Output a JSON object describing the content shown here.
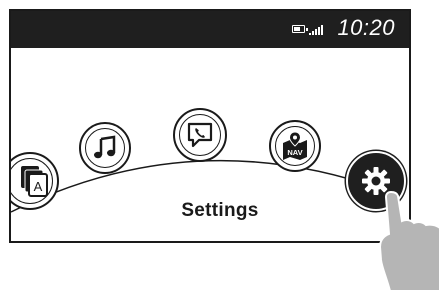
{
  "status_bar": {
    "time": "10:20",
    "battery_icon": "battery-icon",
    "signal_icon": "signal-icon"
  },
  "carousel": {
    "items": [
      {
        "name": "apps",
        "icon": "app-stack-icon",
        "letter": "A"
      },
      {
        "name": "music",
        "icon": "music-note-icon"
      },
      {
        "name": "phone",
        "icon": "phone-message-icon"
      },
      {
        "name": "navigation",
        "icon": "nav-map-icon",
        "letter": "NAV"
      },
      {
        "name": "settings",
        "icon": "gear-icon",
        "selected": true
      }
    ],
    "selected_label": "Settings"
  },
  "colors": {
    "status_bar_bg": "#1f1f1f",
    "ink": "#1a1a1a",
    "hand": "#b5b5b5"
  }
}
